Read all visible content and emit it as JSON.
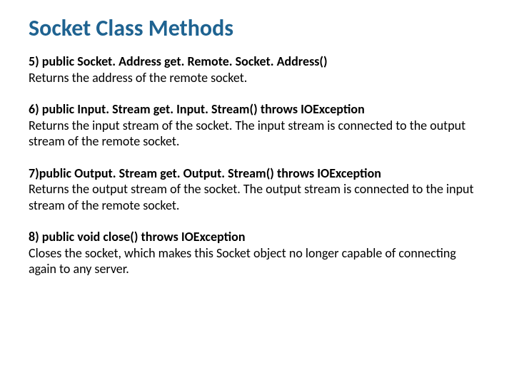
{
  "title": "Socket Class Methods",
  "methods": [
    {
      "signature": "5) public Socket. Address get. Remote. Socket. Address()",
      "description": "Returns the address of the remote socket."
    },
    {
      "signature": "6) public Input. Stream get. Input. Stream() throws IOException",
      "description": "Returns the input stream of the socket. The input stream is connected to the output stream of the remote socket."
    },
    {
      "signature": "7)public Output. Stream get. Output. Stream() throws IOException",
      "description": "Returns the output stream of the socket. The output stream is connected to the input stream of the remote socket."
    },
    {
      "signature": "8) public void close() throws IOException",
      "description": "Closes the socket, which makes this Socket object no longer capable of connecting again to any server."
    }
  ]
}
